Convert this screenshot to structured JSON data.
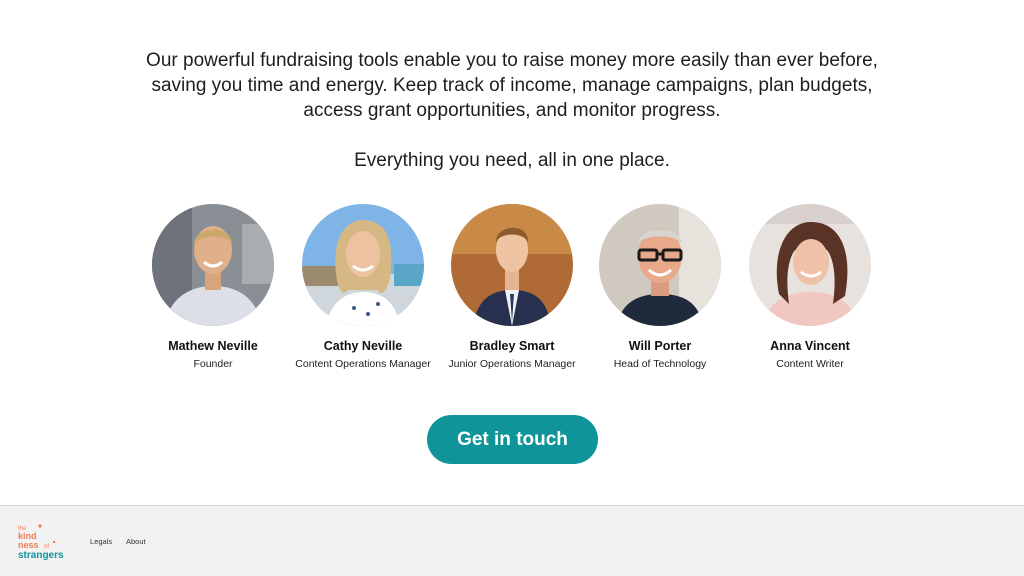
{
  "intro": {
    "paragraph": "Our powerful fundraising tools enable you to raise money more easily than ever before, saving you time and energy. Keep track of income, manage campaigns, plan budgets, access grant opportunities, and monitor progress.",
    "tagline": "Everything you need, all in one place."
  },
  "team": [
    {
      "name": "Mathew Neville",
      "role": "Founder"
    },
    {
      "name": "Cathy Neville",
      "role": "Content Operations Manager"
    },
    {
      "name": "Bradley Smart",
      "role": "Junior Operations Manager"
    },
    {
      "name": "Will Porter",
      "role": "Head of Technology"
    },
    {
      "name": "Anna Vincent",
      "role": "Content Writer"
    }
  ],
  "cta": {
    "label": "Get in touch"
  },
  "footer": {
    "logo": {
      "line1": "the",
      "line2": "kind",
      "line3": "ness",
      "line4": "of",
      "line5": "strangers"
    },
    "links": [
      "Legals",
      "About"
    ]
  },
  "colors": {
    "accent": "#0f9499",
    "logo_orange": "#f07c55",
    "footer_bg": "#f2f2f3"
  }
}
